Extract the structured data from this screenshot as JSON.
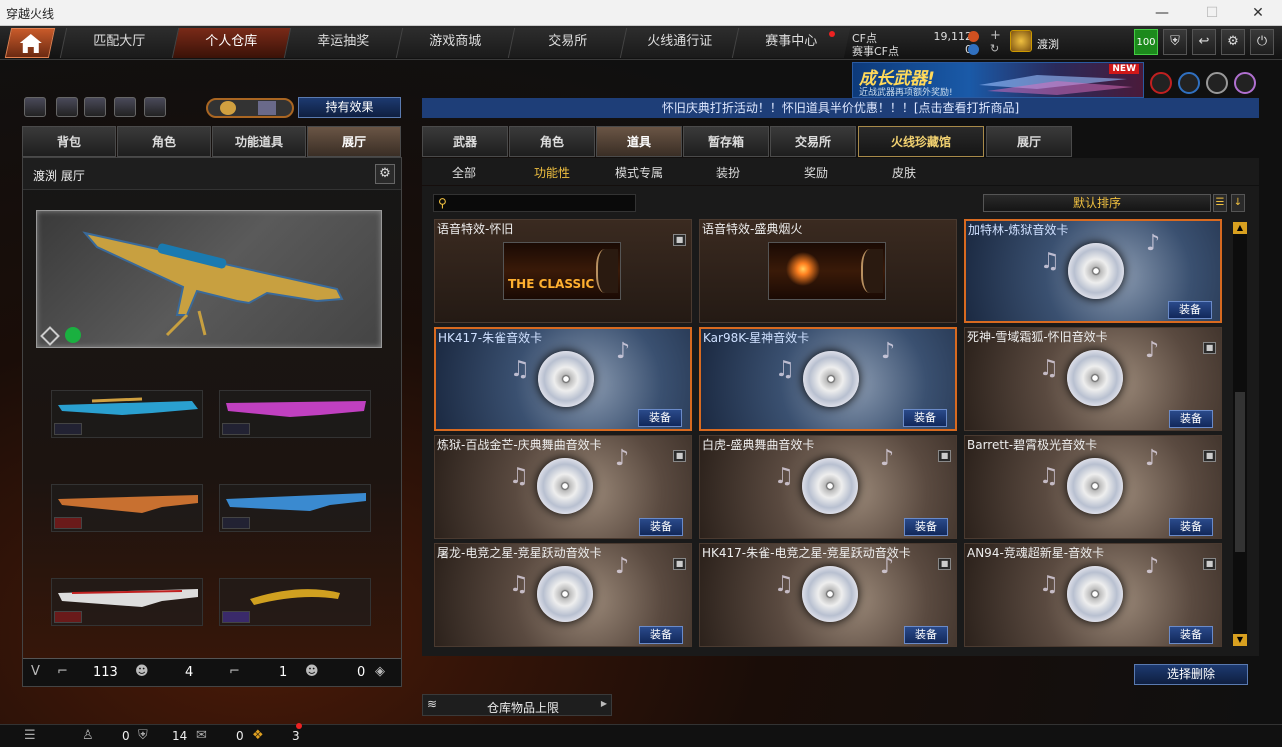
{
  "window": {
    "title": "穿越火线"
  },
  "nav": {
    "tabs": [
      "匹配大厅",
      "个人仓库",
      "幸运抽奖",
      "游戏商城",
      "交易所",
      "火线通行证",
      "赛事中心"
    ],
    "active": "个人仓库"
  },
  "currency": {
    "cf_label": "CF点",
    "cf_value": "19,112",
    "match_cf_label": "赛事CF点",
    "match_cf_value": "0"
  },
  "player": {
    "name": "渡渕",
    "level_badge": "100"
  },
  "banner": {
    "title": "成长武器!",
    "subtitle": "近战武器再项额外奖励!",
    "badge": "NEW"
  },
  "left": {
    "effect_button": "持有效果",
    "tabs": [
      "背包",
      "角色",
      "功能道具",
      "展厅"
    ],
    "active_tab": "展厅",
    "hall_title": "渡渕 展厅",
    "stats": {
      "guns": "113",
      "chars": "4",
      "guns2": "1",
      "chars2": "0"
    }
  },
  "marquee": "怀旧庆典打折活动！！怀旧道具半价优惠！！！[点击查看打折商品]",
  "right": {
    "tabs": [
      "武器",
      "角色",
      "道具",
      "暂存箱",
      "交易所",
      "火线珍藏馆",
      "展厅"
    ],
    "active_tab": "道具",
    "subtabs": [
      "全部",
      "功能性",
      "模式专属",
      "装扮",
      "奖励",
      "皮肤"
    ],
    "active_subtab": "功能性",
    "sort_label": "默认排序",
    "equip_label": "装备",
    "delete_button": "选择删除",
    "capacity_label": "仓库物品上限"
  },
  "items": [
    {
      "name": "语音特效-怀旧",
      "kind": "classic",
      "locked": true,
      "equip": false,
      "selected": false
    },
    {
      "name": "语音特效-盛典烟火",
      "kind": "firework",
      "locked": false,
      "equip": false,
      "selected": false
    },
    {
      "name": "加特林-炼狱音效卡",
      "kind": "blue",
      "locked": false,
      "equip": true,
      "selected": true
    },
    {
      "name": "HK417-朱雀音效卡",
      "kind": "blue",
      "locked": false,
      "equip": true,
      "selected": true
    },
    {
      "name": "Kar98K-星神音效卡",
      "kind": "blue",
      "locked": false,
      "equip": true,
      "selected": true
    },
    {
      "name": "死神-雪域霜狐-怀旧音效卡",
      "kind": "brown",
      "locked": true,
      "equip": true,
      "selected": false
    },
    {
      "name": "炼狱-百战金芒-庆典舞曲音效卡",
      "kind": "brown",
      "locked": true,
      "equip": true,
      "selected": false
    },
    {
      "name": "白虎-盛典舞曲音效卡",
      "kind": "brown",
      "locked": true,
      "equip": true,
      "selected": false
    },
    {
      "name": "Barrett-碧霄极光音效卡",
      "kind": "brown",
      "locked": true,
      "equip": true,
      "selected": false
    },
    {
      "name": "屠龙-电竞之星-竞星跃动音效卡",
      "kind": "brown",
      "locked": true,
      "equip": true,
      "selected": false
    },
    {
      "name": "HK417-朱雀-电竞之星-竞星跃动音效卡",
      "kind": "brown",
      "locked": true,
      "equip": true,
      "selected": false
    },
    {
      "name": "AN94-竞魂超新星-音效卡",
      "kind": "brown",
      "locked": true,
      "equip": true,
      "selected": false
    }
  ],
  "classic_caption": "THE CLASSIC",
  "bottom": {
    "friends": "0",
    "guild": "14",
    "messages": "0",
    "gifts": "3"
  }
}
